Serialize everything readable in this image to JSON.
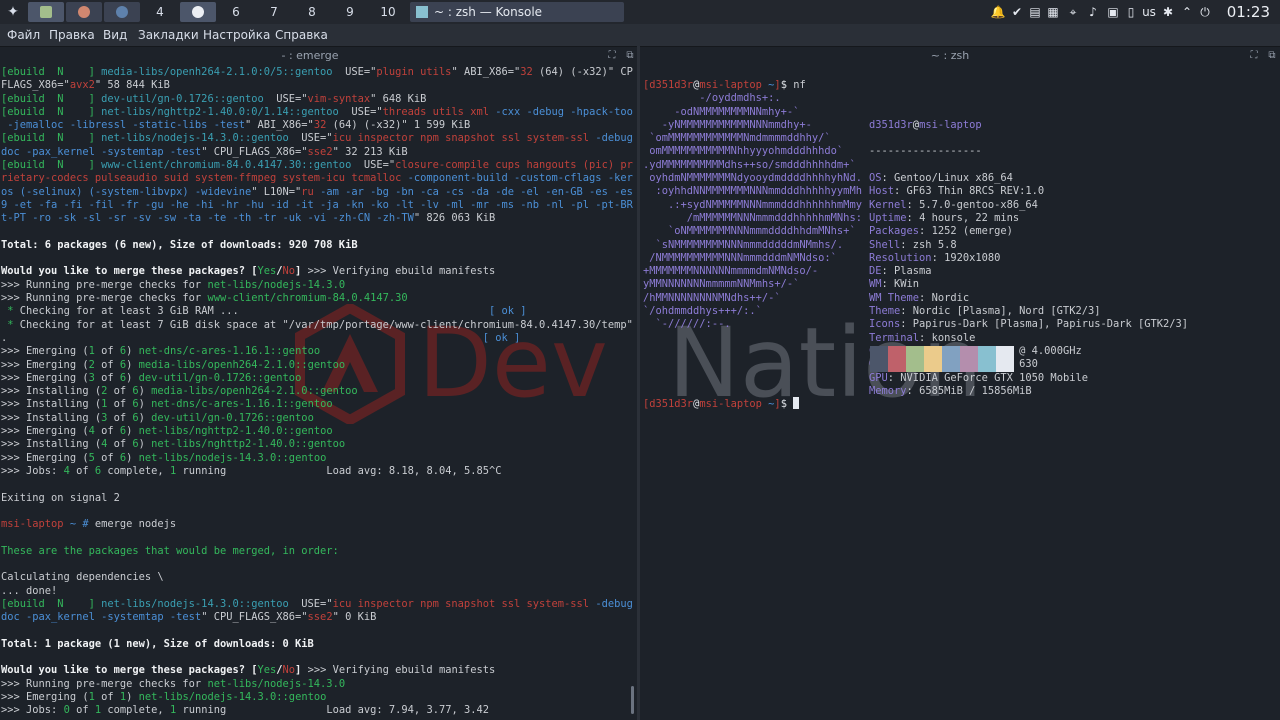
{
  "panel": {
    "launcher_icon": "kde-launcher-icon",
    "pagers": [
      "",
      "",
      "",
      "4",
      "",
      "6",
      "7",
      "8",
      "9",
      "10"
    ],
    "task": {
      "label": "~ : zsh — Konsole"
    },
    "tray": {
      "keyboard_layout": "us"
    },
    "clock": "01:23"
  },
  "menubar": {
    "items": [
      "Файл",
      "Правка",
      "Вид",
      "Закладки",
      "Настройка",
      "Справка"
    ]
  },
  "left_pane": {
    "title": "- : emerge"
  },
  "right_pane": {
    "title": "~ : zsh"
  },
  "watermark": {
    "text_dev": "Dev",
    "text_nation": "Nation"
  },
  "colors": {
    "green": "#34b85c",
    "red": "#c0413b",
    "teal": "#3a9fb2",
    "purple": "#8d7cd6",
    "palette": [
      "#4c566a",
      "#bf616a",
      "#a3be8c",
      "#ebcb8b",
      "#81a1c1",
      "#b48ead",
      "#88c0d0",
      "#e5e9f0"
    ]
  },
  "left_terminal": [
    [
      [
        "c-green",
        "[ebuild  N    ] "
      ],
      [
        "c-teal",
        "media-libs/openh264-2.1.0:0/5::gentoo"
      ],
      [
        "",
        "  USE=\""
      ],
      [
        "c-red",
        "plugin utils"
      ],
      [
        "",
        "\" ABI_X86=\""
      ],
      [
        "c-red",
        "32"
      ],
      [
        "",
        " (64) (-x32)\" CPU_"
      ]
    ],
    [
      [
        "",
        "FLAGS_X86=\""
      ],
      [
        "c-red",
        "avx2"
      ],
      [
        "",
        "\" 58 844 KiB"
      ]
    ],
    [
      [
        "c-green",
        "[ebuild  N    ] "
      ],
      [
        "c-teal",
        "dev-util/gn-0.1726::gentoo"
      ],
      [
        "",
        "  USE=\""
      ],
      [
        "c-red",
        "vim-syntax"
      ],
      [
        "",
        "\" 648 KiB"
      ]
    ],
    [
      [
        "c-green",
        "[ebuild  N    ] "
      ],
      [
        "c-teal",
        "net-libs/nghttp2-1.40.0:0/1.14::gentoo"
      ],
      [
        "",
        "  USE=\""
      ],
      [
        "c-red",
        "threads utils xml"
      ],
      [
        "",
        " "
      ],
      [
        "c-blue",
        "-cxx -debug -hpack-tools"
      ]
    ],
    [
      [
        "c-blue",
        " -jemalloc -libressl -static-libs -test"
      ],
      [
        "",
        "\" ABI_X86=\""
      ],
      [
        "c-red",
        "32"
      ],
      [
        "",
        " (64) (-x32)\" 1 599 KiB"
      ]
    ],
    [
      [
        "c-green",
        "[ebuild  N    ] "
      ],
      [
        "c-teal",
        "net-libs/nodejs-14.3.0::gentoo"
      ],
      [
        "",
        "  USE=\""
      ],
      [
        "c-red",
        "icu inspector npm snapshot ssl system-ssl"
      ],
      [
        "",
        " "
      ],
      [
        "c-blue",
        "-debug -"
      ]
    ],
    [
      [
        "c-blue",
        "doc -pax_kernel -systemtap -test"
      ],
      [
        "",
        "\" CPU_FLAGS_X86=\""
      ],
      [
        "c-red",
        "sse2"
      ],
      [
        "",
        "\" 32 213 KiB"
      ]
    ],
    [
      [
        "c-green",
        "[ebuild  N    ] "
      ],
      [
        "c-teal",
        "www-client/chromium-84.0.4147.30::gentoo"
      ],
      [
        "",
        "  USE=\""
      ],
      [
        "c-red",
        "closure-compile cups hangouts (pic) prop"
      ]
    ],
    [
      [
        "c-red",
        "rietary-codecs pulseaudio suid system-ffmpeg system-icu tcmalloc"
      ],
      [
        "",
        " "
      ],
      [
        "c-blue",
        "-component-build -custom-cflags -kerber"
      ]
    ],
    [
      [
        "c-blue",
        "os (-selinux) (-system-libvpx) -widevine"
      ],
      [
        "",
        "\" L10N=\""
      ],
      [
        "c-red",
        "ru"
      ],
      [
        "",
        " "
      ],
      [
        "c-blue",
        "-am -ar -bg -bn -ca -cs -da -de -el -en-GB -es -es-41"
      ]
    ],
    [
      [
        "c-blue",
        "9 -et -fa -fi -fil -fr -gu -he -hi -hr -hu -id -it -ja -kn -ko -lt -lv -ml -mr -ms -nb -nl -pl -pt-BR -p"
      ]
    ],
    [
      [
        "c-blue",
        "t-PT -ro -sk -sl -sr -sv -sw -ta -te -th -tr -uk -vi -zh-CN -zh-TW"
      ],
      [
        "",
        "\" 826 063 KiB"
      ]
    ],
    [
      [
        "",
        ""
      ]
    ],
    [
      [
        "c-bold",
        "Total: 6 packages (6 new), Size of downloads: 920 708 KiB"
      ]
    ],
    [
      [
        "",
        ""
      ]
    ],
    [
      [
        "c-bold",
        "Would you like to merge these packages? ["
      ],
      [
        "c-green",
        "Yes"
      ],
      [
        "c-bold",
        "/"
      ],
      [
        "c-red",
        "No"
      ],
      [
        "c-bold",
        "]"
      ],
      [
        "",
        " >>> Verifying ebuild manifests"
      ]
    ],
    [
      [
        "",
        ">>> Running pre-merge checks for "
      ],
      [
        "c-green",
        "net-libs/nodejs-14.3.0"
      ]
    ],
    [
      [
        "",
        ">>> Running pre-merge checks for "
      ],
      [
        "c-green",
        "www-client/chromium-84.0.4147.30"
      ]
    ],
    [
      [
        "c-green",
        " * "
      ],
      [
        "",
        "Checking for at least 3 GiB RAM ...                                        "
      ],
      [
        "c-blue",
        "[ ok ]"
      ]
    ],
    [
      [
        "c-green",
        " * "
      ],
      [
        "",
        "Checking for at least 7 GiB disk space at \"/var/tmp/portage/www-client/chromium-84.0.4147.30/temp\" .."
      ]
    ],
    [
      [
        "",
        ".                                                                            "
      ],
      [
        "c-blue",
        "[ ok ]"
      ]
    ],
    [
      [
        "",
        ">>> Emerging ("
      ],
      [
        "c-green",
        "1"
      ],
      [
        "",
        " of "
      ],
      [
        "c-green",
        "6"
      ],
      [
        "",
        ") "
      ],
      [
        "c-green",
        "net-dns/c-ares-1.16.1::gentoo"
      ]
    ],
    [
      [
        "",
        ">>> Emerging ("
      ],
      [
        "c-green",
        "2"
      ],
      [
        "",
        " of "
      ],
      [
        "c-green",
        "6"
      ],
      [
        "",
        ") "
      ],
      [
        "c-green",
        "media-libs/openh264-2.1.0::gentoo"
      ]
    ],
    [
      [
        "",
        ">>> Emerging ("
      ],
      [
        "c-green",
        "3"
      ],
      [
        "",
        " of "
      ],
      [
        "c-green",
        "6"
      ],
      [
        "",
        ") "
      ],
      [
        "c-green",
        "dev-util/gn-0.1726::gentoo"
      ]
    ],
    [
      [
        "",
        ">>> Installing ("
      ],
      [
        "c-green",
        "2"
      ],
      [
        "",
        " of "
      ],
      [
        "c-green",
        "6"
      ],
      [
        "",
        ") "
      ],
      [
        "c-green",
        "media-libs/openh264-2.1.0::gentoo"
      ]
    ],
    [
      [
        "",
        ">>> Installing ("
      ],
      [
        "c-green",
        "1"
      ],
      [
        "",
        " of "
      ],
      [
        "c-green",
        "6"
      ],
      [
        "",
        ") "
      ],
      [
        "c-green",
        "net-dns/c-ares-1.16.1::gentoo"
      ]
    ],
    [
      [
        "",
        ">>> Installing ("
      ],
      [
        "c-green",
        "3"
      ],
      [
        "",
        " of "
      ],
      [
        "c-green",
        "6"
      ],
      [
        "",
        ") "
      ],
      [
        "c-green",
        "dev-util/gn-0.1726::gentoo"
      ]
    ],
    [
      [
        "",
        ">>> Emerging ("
      ],
      [
        "c-green",
        "4"
      ],
      [
        "",
        " of "
      ],
      [
        "c-green",
        "6"
      ],
      [
        "",
        ") "
      ],
      [
        "c-green",
        "net-libs/nghttp2-1.40.0::gentoo"
      ]
    ],
    [
      [
        "",
        ">>> Installing ("
      ],
      [
        "c-green",
        "4"
      ],
      [
        "",
        " of "
      ],
      [
        "c-green",
        "6"
      ],
      [
        "",
        ") "
      ],
      [
        "c-green",
        "net-libs/nghttp2-1.40.0::gentoo"
      ]
    ],
    [
      [
        "",
        ">>> Emerging ("
      ],
      [
        "c-green",
        "5"
      ],
      [
        "",
        " of "
      ],
      [
        "c-green",
        "6"
      ],
      [
        "",
        ") "
      ],
      [
        "c-green",
        "net-libs/nodejs-14.3.0::gentoo"
      ]
    ],
    [
      [
        "",
        ">>> Jobs: "
      ],
      [
        "c-green",
        "4"
      ],
      [
        "",
        " of "
      ],
      [
        "c-green",
        "6"
      ],
      [
        "",
        " complete, "
      ],
      [
        "c-green",
        "1"
      ],
      [
        "",
        " running                Load avg: 8.18, 8.04, 5.85^C"
      ]
    ],
    [
      [
        "",
        ""
      ]
    ],
    [
      [
        "",
        "Exiting on signal 2"
      ]
    ],
    [
      [
        "",
        ""
      ]
    ],
    [
      [
        "c-red",
        "msi-laptop"
      ],
      [
        "",
        " "
      ],
      [
        "c-blue",
        "~ #"
      ],
      [
        "",
        " emerge nodejs"
      ]
    ],
    [
      [
        "",
        ""
      ]
    ],
    [
      [
        "c-green",
        "These are the packages that would be merged, in order:"
      ]
    ],
    [
      [
        "",
        ""
      ]
    ],
    [
      [
        "",
        "Calculating dependencies \\"
      ]
    ],
    [
      [
        "",
        "... done!"
      ]
    ],
    [
      [
        "c-green",
        "[ebuild  N    ] "
      ],
      [
        "c-teal",
        "net-libs/nodejs-14.3.0::gentoo"
      ],
      [
        "",
        "  USE=\""
      ],
      [
        "c-red",
        "icu inspector npm snapshot ssl system-ssl"
      ],
      [
        "",
        " "
      ],
      [
        "c-blue",
        "-debug -"
      ]
    ],
    [
      [
        "c-blue",
        "doc -pax_kernel -systemtap -test"
      ],
      [
        "",
        "\" CPU_FLAGS_X86=\""
      ],
      [
        "c-red",
        "sse2"
      ],
      [
        "",
        "\" 0 KiB"
      ]
    ],
    [
      [
        "",
        ""
      ]
    ],
    [
      [
        "c-bold",
        "Total: 1 package (1 new), Size of downloads: 0 KiB"
      ]
    ],
    [
      [
        "",
        ""
      ]
    ],
    [
      [
        "c-bold",
        "Would you like to merge these packages? ["
      ],
      [
        "c-green",
        "Yes"
      ],
      [
        "c-bold",
        "/"
      ],
      [
        "c-red",
        "No"
      ],
      [
        "c-bold",
        "]"
      ],
      [
        "",
        " >>> Verifying ebuild manifests"
      ]
    ],
    [
      [
        "",
        ">>> Running pre-merge checks for "
      ],
      [
        "c-green",
        "net-libs/nodejs-14.3.0"
      ]
    ],
    [
      [
        "",
        ">>> Emerging ("
      ],
      [
        "c-green",
        "1"
      ],
      [
        "",
        " of "
      ],
      [
        "c-green",
        "1"
      ],
      [
        "",
        ") "
      ],
      [
        "c-green",
        "net-libs/nodejs-14.3.0::gentoo"
      ]
    ],
    [
      [
        "",
        ">>> Jobs: "
      ],
      [
        "c-green",
        "0"
      ],
      [
        "",
        " of "
      ],
      [
        "c-green",
        "1"
      ],
      [
        "",
        " complete, "
      ],
      [
        "c-green",
        "1"
      ],
      [
        "",
        " running                Load avg: 7.94, 3.77, 3.42"
      ]
    ]
  ],
  "right_terminal": {
    "prompt_user": "d351d3r",
    "prompt_host": "msi-laptop",
    "prompt_dir": "~",
    "command": "nf",
    "logo": [
      "",
      "         -/oyddmdhs+:.",
      "     -odNMMMMMMMMNNmhy+-`",
      "   -yNMMMMMMMMMMMNNNmmdhy+-",
      " `omMMMMMMMMMMMMNmdmmmmddhhy/`",
      " omMMMMMMMMMMMNhhyyyohmdddhhhdo`",
      ".ydMMMMMMMMMMdhs++so/smdddhhhhdm+`",
      " oyhdmNMMMMMMMNdyooydmddddhhhhyhNd.",
      "  :oyhhdNNMMMMMMMNNNmmdddhhhhhyymMh",
      "    .:+sydNMMMMMNNNmmmdddhhhhhhmMmy",
      "       /mMMMMMMNNNmmmdddhhhhhmMNhs:",
      "    `oNMMMMMMMNNNmmmddddhhdmMNhs+`",
      "  `sNMMMMMMMMNNNmmmdddddmNMmhs/.",
      " /NMMMMMMMMMMNNNmmmdddmNMNdso:`",
      "+MMMMMMMNNNNNNmmmmdmNMNdso/-",
      "yMMNNNNNNNmmmmmNNMmhs+/-`",
      "/hMMNNNNNNNNMNdhs++/-`",
      "`/ohdmmddhys+++/:.`",
      "  `-//////:--."
    ],
    "info_header_user": "d351d3r",
    "info_header_host": "msi-laptop",
    "info_sep": "------------------",
    "info": [
      {
        "k": "OS",
        "v": "Gentoo/Linux x86_64"
      },
      {
        "k": "Host",
        "v": "GF63 Thin 8RCS REV:1.0"
      },
      {
        "k": "Kernel",
        "v": "5.7.0-gentoo-x86_64"
      },
      {
        "k": "Uptime",
        "v": "4 hours, 22 mins"
      },
      {
        "k": "Packages",
        "v": "1252 (emerge)"
      },
      {
        "k": "Shell",
        "v": "zsh 5.8"
      },
      {
        "k": "Resolution",
        "v": "1920x1080"
      },
      {
        "k": "DE",
        "v": "Plasma"
      },
      {
        "k": "WM",
        "v": "KWin"
      },
      {
        "k": "WM Theme",
        "v": "Nordic"
      },
      {
        "k": "Theme",
        "v": "Nordic [Plasma], Nord [GTK2/3]"
      },
      {
        "k": "Icons",
        "v": "Papirus-Dark [Plasma], Papirus-Dark [GTK2/3]"
      },
      {
        "k": "Terminal",
        "v": "konsole"
      },
      {
        "k": "CPU",
        "v": "Intel i5-8300H (8) @ 4.000GHz"
      },
      {
        "k": "GPU",
        "v": "Intel UHD Graphics 630"
      },
      {
        "k": "GPU",
        "v": "NVIDIA GeForce GTX 1050 Mobile"
      },
      {
        "k": "Memory",
        "v": "6585MiB / 15856MiB"
      }
    ]
  }
}
